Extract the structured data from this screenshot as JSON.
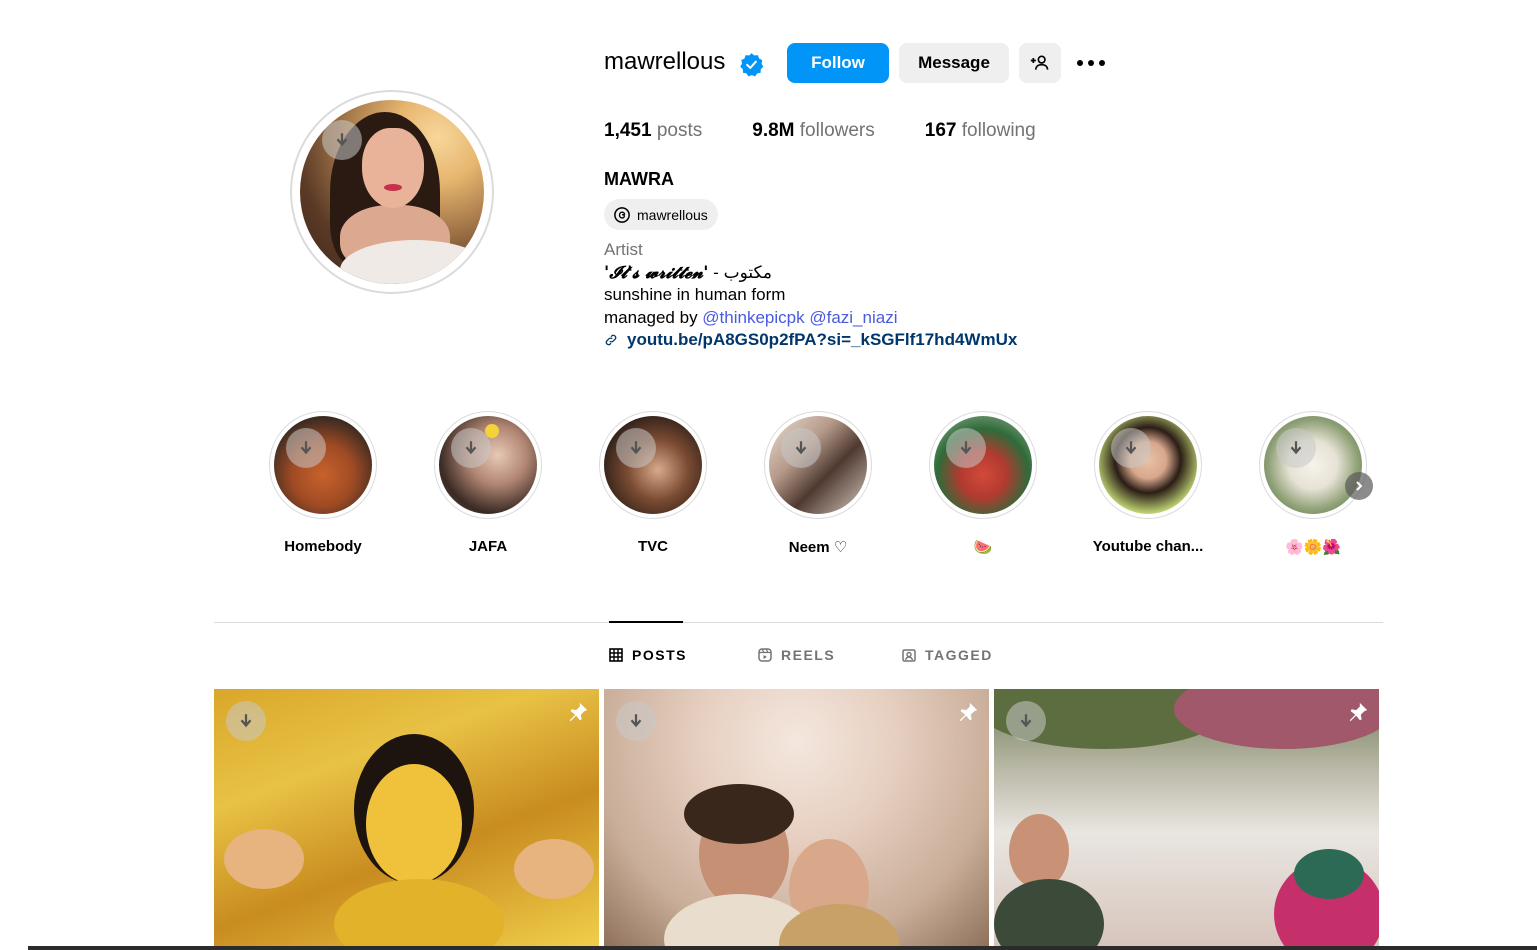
{
  "profile": {
    "username": "mawrellous",
    "follow_label": "Follow",
    "message_label": "Message",
    "posts_count": "1,451",
    "posts_label": "posts",
    "followers_count": "9.8M",
    "followers_label": "followers",
    "following_count": "167",
    "following_label": "following",
    "full_name": "MAWRA",
    "threads_handle": "mawrellous",
    "category": "Artist",
    "bio_line1_quote": "'𝓘𝓽'𝓼 𝔀𝓻𝓲𝓽𝓽𝓮𝓷'",
    "bio_line1_rest": " - مکتوب",
    "bio_line2": "sunshine in human form",
    "bio_line3_prefix": "managed by ",
    "mention1": "@thinkepicpk",
    "mention2": "@fazi_niazi",
    "link": "youtu.be/pA8GS0p2fPA?si=_kSGFlf17hd4WmUx"
  },
  "highlights": [
    {
      "label": "Homebody"
    },
    {
      "label": "JAFA"
    },
    {
      "label": "TVC"
    },
    {
      "label": "Neem ♡"
    },
    {
      "label": "🍉"
    },
    {
      "label": "Youtube chan..."
    },
    {
      "label": "🌸🌼🌺"
    }
  ],
  "tabs": {
    "posts": "POSTS",
    "reels": "REELS",
    "tagged": "TAGGED"
  },
  "colors": {
    "follow_button": "#0095f6",
    "secondary_button": "#efefef",
    "mention": "#4a5ae0",
    "link": "#00376b",
    "muted_text": "#737373"
  }
}
